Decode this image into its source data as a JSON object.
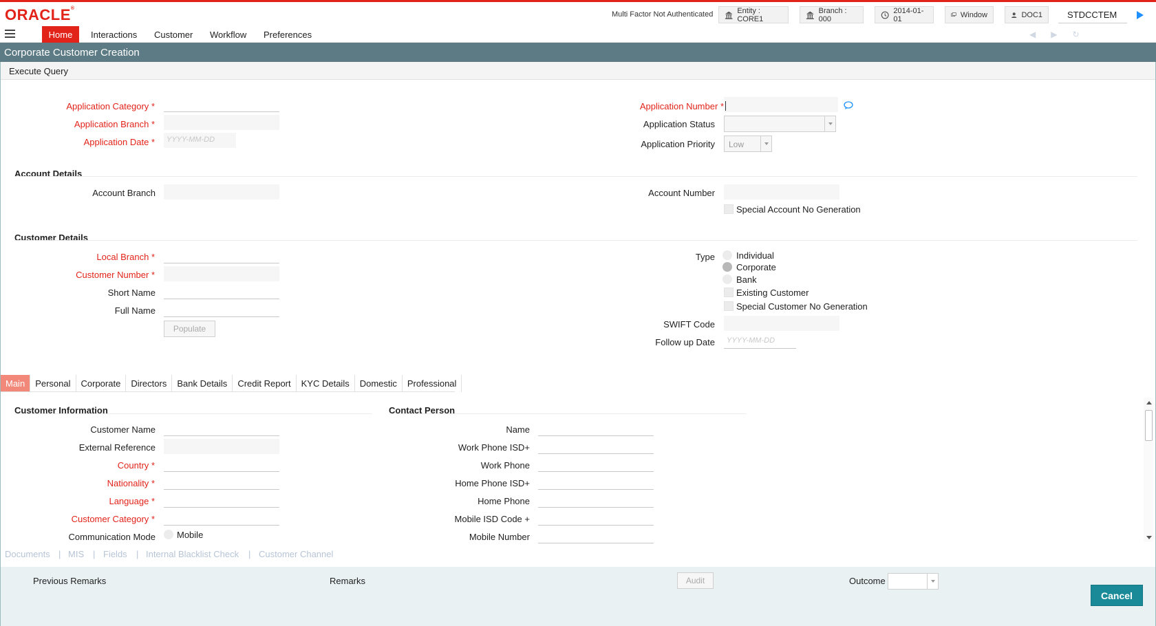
{
  "header": {
    "logo": "ORACLE",
    "mfa": "Multi Factor Not Authenticated",
    "entity": "Entity : CORE1",
    "branch": "Branch : 000",
    "date": "2014-01-01",
    "window": "Window",
    "user": "DOC1",
    "user_name": "STDCCTEM"
  },
  "menu": {
    "home": "Home",
    "interactions": "Interactions",
    "customer": "Customer",
    "workflow": "Workflow",
    "preferences": "Preferences"
  },
  "window_title": "Corporate Customer Creation",
  "execute_query": "Execute Query",
  "app": {
    "category_label": "Application Category",
    "branch_label": "Application Branch",
    "date_label": "Application Date",
    "date_placeholder": "YYYY-MM-DD",
    "number_label": "Application Number",
    "status_label": "Application Status",
    "priority_label": "Application Priority",
    "priority_value": "Low"
  },
  "account": {
    "title": "Account Details",
    "branch_label": "Account Branch",
    "number_label": "Account Number",
    "special_label": "Special Account No Generation"
  },
  "customer": {
    "title": "Customer Details",
    "local_branch_label": "Local Branch",
    "number_label": "Customer Number",
    "short_name_label": "Short Name",
    "full_name_label": "Full Name",
    "populate": "Populate",
    "type_label": "Type",
    "type_individual": "Individual",
    "type_corporate": "Corporate",
    "type_bank": "Bank",
    "existing_label": "Existing Customer",
    "special_label": "Special Customer No Generation",
    "swift_label": "SWIFT Code",
    "followup_label": "Follow up Date",
    "followup_placeholder": "YYYY-MM-DD"
  },
  "tabs": [
    "Main",
    "Personal",
    "Corporate",
    "Directors",
    "Bank Details",
    "Credit Report",
    "KYC Details",
    "Domestic",
    "Professional"
  ],
  "info": {
    "title": "Customer Information",
    "customer_name": "Customer Name",
    "external_reference": "External Reference",
    "country": "Country",
    "nationality": "Nationality",
    "language": "Language",
    "customer_category": "Customer Category",
    "communication_mode": "Communication Mode",
    "mode_mobile": "Mobile"
  },
  "contact": {
    "title": "Contact Person",
    "name": "Name",
    "work_isd": "Work Phone ISD+",
    "work_phone": "Work Phone",
    "home_isd": "Home Phone ISD+",
    "home_phone": "Home Phone",
    "mobile_isd": "Mobile ISD Code +",
    "mobile_number": "Mobile Number"
  },
  "links": [
    "Documents",
    "MIS",
    "Fields",
    "Internal Blacklist Check",
    "Customer Channel"
  ],
  "footer": {
    "previous_remarks": "Previous Remarks",
    "remarks": "Remarks",
    "audit": "Audit",
    "outcome": "Outcome",
    "cancel": "Cancel"
  }
}
